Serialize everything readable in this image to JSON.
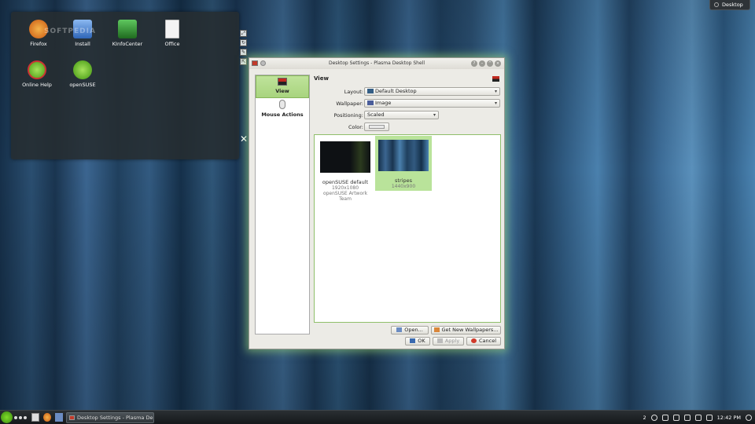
{
  "desktop": {
    "toolbox_label": "Desktop",
    "folder_icons": [
      {
        "label": "Firefox",
        "color": "#e07a1c"
      },
      {
        "label": "Install",
        "color": "#5a8fd0"
      },
      {
        "label": "KInfoCenter",
        "color": "#3a9a3a"
      },
      {
        "label": "Office",
        "color": "#eeeeee"
      },
      {
        "label": "Online Help",
        "color": "#73c32f"
      },
      {
        "label": "openSUSE",
        "color": "#73c32f"
      }
    ],
    "watermark": "SOFTPEDIA"
  },
  "dialog": {
    "title": "Desktop Settings - Plasma Desktop Shell",
    "sidebar": [
      {
        "label": "View",
        "active": true
      },
      {
        "label": "Mouse Actions",
        "active": false
      }
    ],
    "pane_title": "View",
    "form": {
      "layout_label": "Layout:",
      "layout_value": "Default Desktop",
      "wallpaper_label": "Wallpaper:",
      "wallpaper_value": "Image",
      "positioning_label": "Positioning:",
      "positioning_value": "Scaled",
      "color_label": "Color:"
    },
    "wallpapers": [
      {
        "name": "openSUSE default",
        "size": "1920x1080",
        "author": "openSUSE Artwork Team",
        "selected": false
      },
      {
        "name": "stripes",
        "size": "1440x900",
        "author": "",
        "selected": true
      }
    ],
    "buttons": {
      "open": "Open...",
      "get_new": "Get New Wallpapers...",
      "ok": "OK",
      "apply": "Apply",
      "cancel": "Cancel"
    }
  },
  "taskbar": {
    "task_label": "Desktop Settings - Plasma De",
    "desktop_number": "2",
    "clock": "12:42 PM"
  }
}
